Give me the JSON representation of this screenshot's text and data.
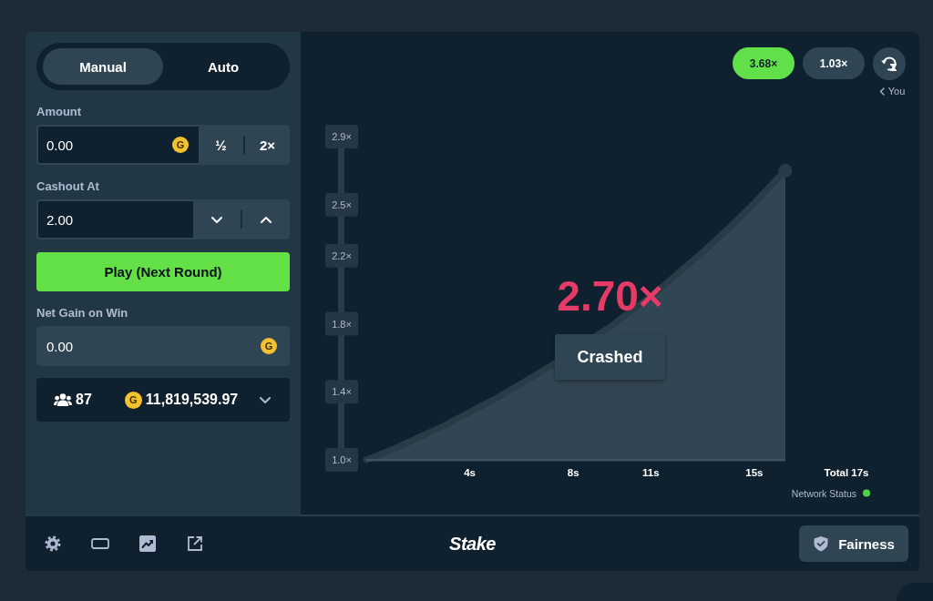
{
  "bet_panel": {
    "mode_tabs": [
      {
        "label": "Manual",
        "selected": true
      },
      {
        "label": "Auto",
        "selected": false
      }
    ],
    "amount": {
      "label": "Amount",
      "value": "0.00",
      "currency": "G",
      "buttons": [
        "½",
        "2×"
      ]
    },
    "cashout": {
      "label": "Cashout At",
      "value": "2.00"
    },
    "play_button": "Play (Next Round)",
    "net_gain": {
      "label": "Net Gain on Win",
      "value": "0.00",
      "currency": "G"
    },
    "stats": {
      "players": "87",
      "currency": "G",
      "total": "11,819,539.97"
    }
  },
  "game": {
    "recent_multipliers": [
      {
        "value": "3.68×",
        "color": "#62e04a"
      },
      {
        "value": "1.03×",
        "color": "#2f4553"
      }
    ],
    "history_caption": "You",
    "chart": {
      "chart_data": {
        "type": "area",
        "x": [
          0,
          1,
          2,
          3,
          4,
          5,
          6,
          7,
          9.5,
          10,
          11,
          12,
          13,
          14,
          15,
          16,
          16.2
        ],
        "values": [
          1.0,
          1.06,
          1.13,
          1.2,
          1.28,
          1.36,
          1.45,
          1.54,
          1.79,
          1.85,
          1.96,
          2.09,
          2.22,
          2.36,
          2.51,
          2.67,
          2.7
        ],
        "xlim": [
          0,
          16.2
        ],
        "ylim": [
          1.0,
          2.9
        ],
        "xticks": [
          {
            "value": 4,
            "label": "4s"
          },
          {
            "value": 8,
            "label": "8s"
          },
          {
            "value": 11,
            "label": "11s"
          },
          {
            "value": 15,
            "label": "15s"
          }
        ],
        "yticks": [
          {
            "value": 1.0,
            "label": "1.0×"
          },
          {
            "value": 1.4,
            "label": "1.4×"
          },
          {
            "value": 1.8,
            "label": "1.8×"
          },
          {
            "value": 2.2,
            "label": "2.2×"
          },
          {
            "value": 2.5,
            "label": "2.5×"
          },
          {
            "value": 2.9,
            "label": "2.9×"
          }
        ]
      },
      "total_time": "Total 17s",
      "multiplier": "2.70×",
      "status": "Crashed",
      "network_status": {
        "label": "Network Status",
        "online": true
      }
    }
  },
  "footer": {
    "logo": "Stake",
    "fairness_button": "Fairness"
  }
}
